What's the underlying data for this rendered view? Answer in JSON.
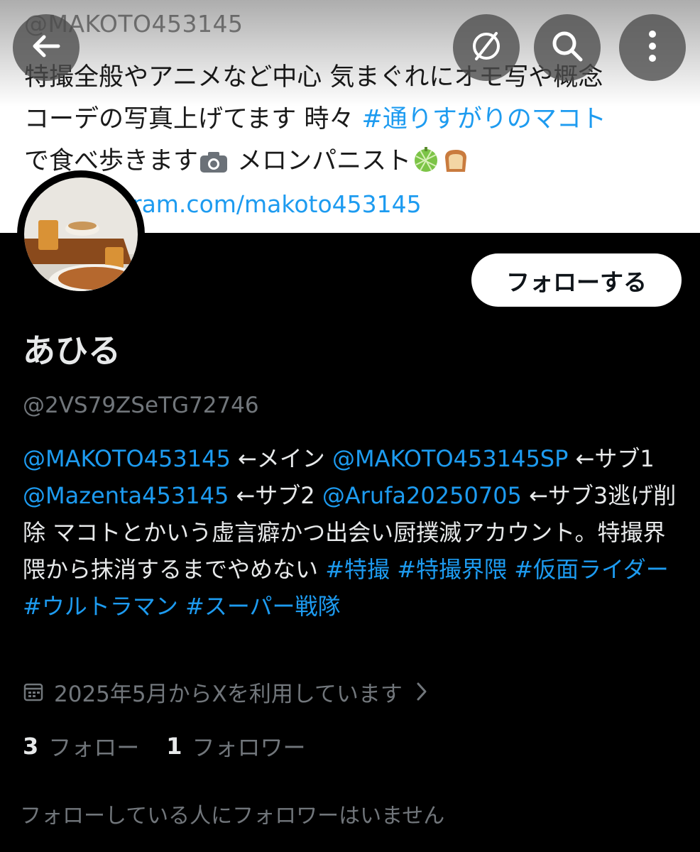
{
  "banner": {
    "handle": "@MAKOTO453145",
    "bio_line1": "特撮全般やアニメなど中心 気まぐれにオモ写や概念",
    "bio_line2_prefix": "コーデの写真上げてます 時々 ",
    "bio_line2_tag": "#通りすがりのマコト",
    "bio_line3_prefix": "で食べ歩きます",
    "bio_line3_suffix": " メロンパニスト",
    "link_text": "ram.com/makoto453145",
    "emoji": [
      "camera-emoji",
      "melon-emoji",
      "bread-emoji"
    ]
  },
  "toolbar": {
    "back_icon": "arrow-left-icon",
    "hide_icon": "eye-slash-icon",
    "search_icon": "search-icon",
    "more_icon": "more-vertical-icon"
  },
  "profile": {
    "follow_label": "フォローする",
    "display_name": "あひる",
    "handle": "@2VS79ZSeTG72746",
    "bio": [
      {
        "t": "@MAKOTO453145",
        "link": true
      },
      {
        "t": " ←メイン ",
        "link": false
      },
      {
        "t": "@MAKOTO453145SP",
        "link": true
      },
      {
        "t": "  ←サブ1 ",
        "link": false
      },
      {
        "t": "@Mazenta453145",
        "link": true
      },
      {
        "t": " ←サブ2 ",
        "link": false
      },
      {
        "t": "@Arufa20250705",
        "link": true
      },
      {
        "t": " ←サブ3逃げ削除 マコトとかいう虚言癖かつ出会い厨撲滅アカウント。特撮界隈から抹消するまでやめない ",
        "link": false
      },
      {
        "t": "#特撮",
        "link": true
      },
      {
        "t": " ",
        "link": false
      },
      {
        "t": "#特撮界隈",
        "link": true
      },
      {
        "t": " ",
        "link": false
      },
      {
        "t": "#仮面ライダー",
        "link": true
      },
      {
        "t": " ",
        "link": false
      },
      {
        "t": "#ウルトラマン",
        "link": true
      },
      {
        "t": " ",
        "link": false
      },
      {
        "t": "#スーパー戦隊",
        "link": true
      }
    ],
    "joined": "2025年5月からXを利用しています",
    "following_count": "3",
    "following_label": "フォロー",
    "followers_count": "1",
    "followers_label": "フォロワー",
    "no_mutual": "フォローしている人にフォロワーはいません"
  },
  "colors": {
    "accent": "#1d9bf0",
    "background": "#000000",
    "muted": "#71767b"
  }
}
